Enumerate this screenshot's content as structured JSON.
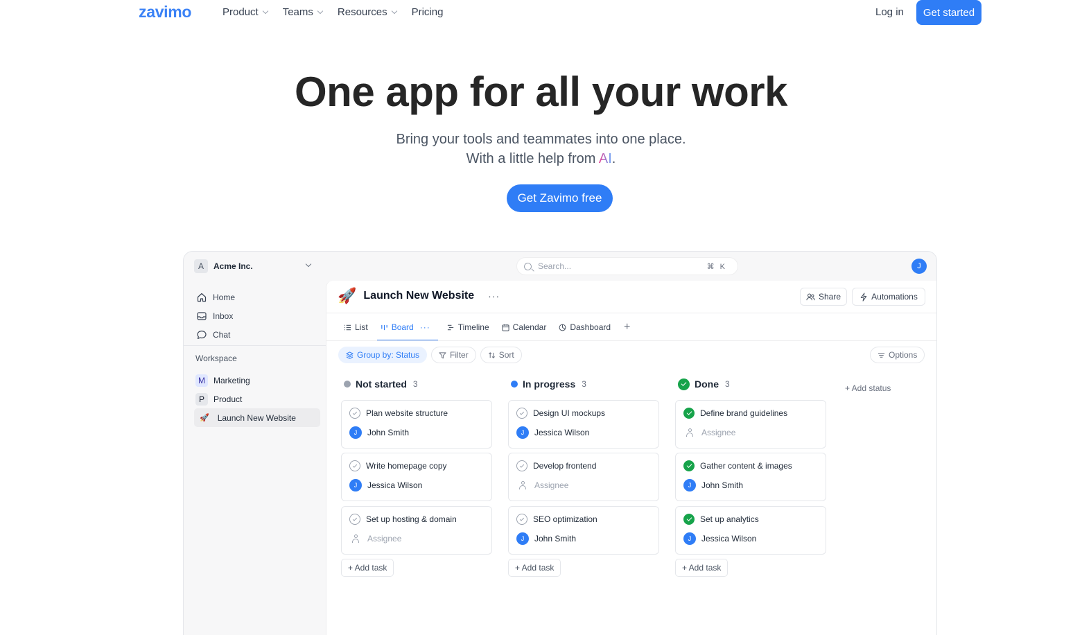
{
  "nav": {
    "logo": "zavimo",
    "links": [
      {
        "label": "Product",
        "has_menu": true
      },
      {
        "label": "Teams",
        "has_menu": true
      },
      {
        "label": "Resources",
        "has_menu": true
      },
      {
        "label": "Pricing",
        "has_menu": false
      }
    ],
    "login": "Log in",
    "get_started": "Get started"
  },
  "hero": {
    "title": "One app for all your work",
    "subtitle_line1": "Bring your tools and teammates into one place.",
    "subtitle_line2_prefix": "With a little help from ",
    "subtitle_line2_ai": "AI",
    "subtitle_line2_suffix": ".",
    "cta": "Get Zavimo free"
  },
  "app": {
    "workspace": {
      "badge": "A",
      "name": "Acme Inc."
    },
    "search": {
      "placeholder": "Search...",
      "shortcut": "⌘K"
    },
    "user_initial": "J",
    "sidebar": {
      "items": [
        {
          "label": "Home",
          "icon": "home-icon"
        },
        {
          "label": "Inbox",
          "icon": "inbox-icon"
        },
        {
          "label": "Chat",
          "icon": "chat-icon"
        }
      ],
      "workspace_label": "Workspace",
      "projects": [
        {
          "badge": "M",
          "label": "Marketing",
          "badge_bg": "#e0e7ff",
          "badge_color": "#3730a3"
        },
        {
          "badge": "P",
          "label": "Product",
          "badge_bg": "#e5e7eb",
          "badge_color": "#111827"
        },
        {
          "badge": "🚀",
          "label": "Launch New Website",
          "active": true
        }
      ]
    },
    "project": {
      "emoji": "🚀",
      "title": "Launch New Website",
      "more": "···",
      "share": "Share",
      "automations": "Automations"
    },
    "tabs": [
      {
        "label": "List",
        "icon": "list-icon"
      },
      {
        "label": "Board",
        "icon": "board-icon",
        "active": true,
        "more": "···"
      },
      {
        "label": "Timeline",
        "icon": "timeline-icon"
      },
      {
        "label": "Calendar",
        "icon": "calendar-icon"
      },
      {
        "label": "Dashboard",
        "icon": "dashboard-icon"
      }
    ],
    "tab_add": "+",
    "filters": {
      "group_by": "Group by: Status",
      "filter": "Filter",
      "sort": "Sort",
      "options": "Options"
    },
    "board": {
      "columns": [
        {
          "name": "Not started",
          "count": "3",
          "color": "#9ca3af",
          "status": "todo",
          "tasks": [
            {
              "title": "Plan website structure",
              "assignee": "John Smith",
              "initial": "J"
            },
            {
              "title": "Write homepage copy",
              "assignee": "Jessica Wilson",
              "initial": "J"
            },
            {
              "title": "Set up hosting & domain",
              "assignee": null
            }
          ]
        },
        {
          "name": "In progress",
          "count": "3",
          "color": "#2f7df6",
          "status": "todo",
          "tasks": [
            {
              "title": "Design UI mockups",
              "assignee": "Jessica Wilson",
              "initial": "J"
            },
            {
              "title": "Develop frontend",
              "assignee": null
            },
            {
              "title": "SEO optimization",
              "assignee": "John Smith",
              "initial": "J"
            }
          ]
        },
        {
          "name": "Done",
          "count": "3",
          "color": "#16a34a",
          "status": "done",
          "tasks": [
            {
              "title": "Define brand guidelines",
              "assignee": null
            },
            {
              "title": "Gather content & images",
              "assignee": "John Smith",
              "initial": "J"
            },
            {
              "title": "Set up analytics",
              "assignee": "Jessica Wilson",
              "initial": "J"
            }
          ]
        }
      ],
      "assignee_placeholder": "Assignee",
      "add_task": "+ Add task",
      "add_status": "+ Add status"
    }
  }
}
